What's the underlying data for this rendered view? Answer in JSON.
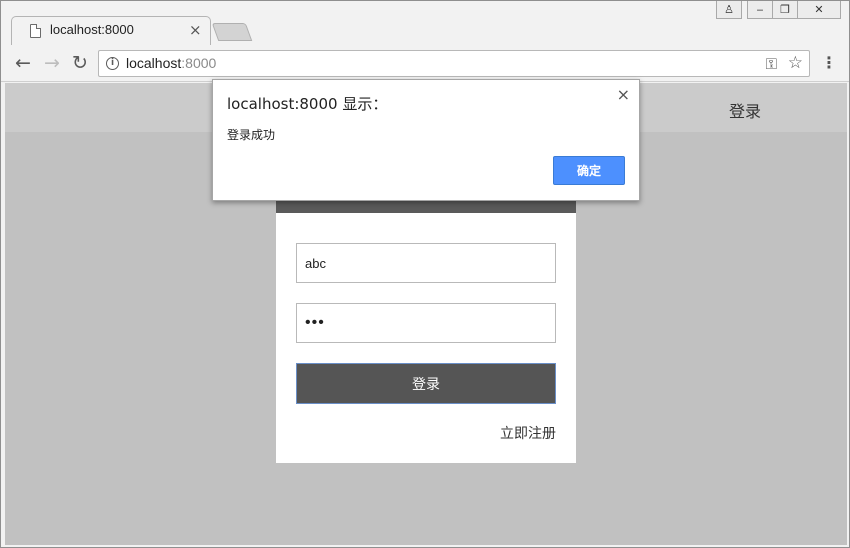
{
  "browser": {
    "tab": {
      "title": "localhost:8000",
      "close_glyph": "×"
    },
    "window_controls": {
      "user_glyph": "♙",
      "minimize_glyph": "‒",
      "restore_glyph": "❐",
      "close_glyph": "✕"
    },
    "nav": {
      "back_glyph": "←",
      "forward_glyph": "→",
      "reload_glyph": "↻"
    },
    "omnibox": {
      "host": "localhost",
      "port": ":8000",
      "info_glyph": "i",
      "key_glyph": "⚿",
      "star_glyph": "☆"
    },
    "menu_glyph": "⋮"
  },
  "page": {
    "header": {
      "login_label": "登录"
    },
    "form": {
      "username_value": "abc",
      "password_value": "•••",
      "submit_label": "登录",
      "register_label": "立即注册"
    }
  },
  "dialog": {
    "title": "localhost:8000 显示：",
    "message": "登录成功",
    "ok_label": "确定",
    "close_glyph": "×",
    "accent_color": "#4d90fe"
  }
}
